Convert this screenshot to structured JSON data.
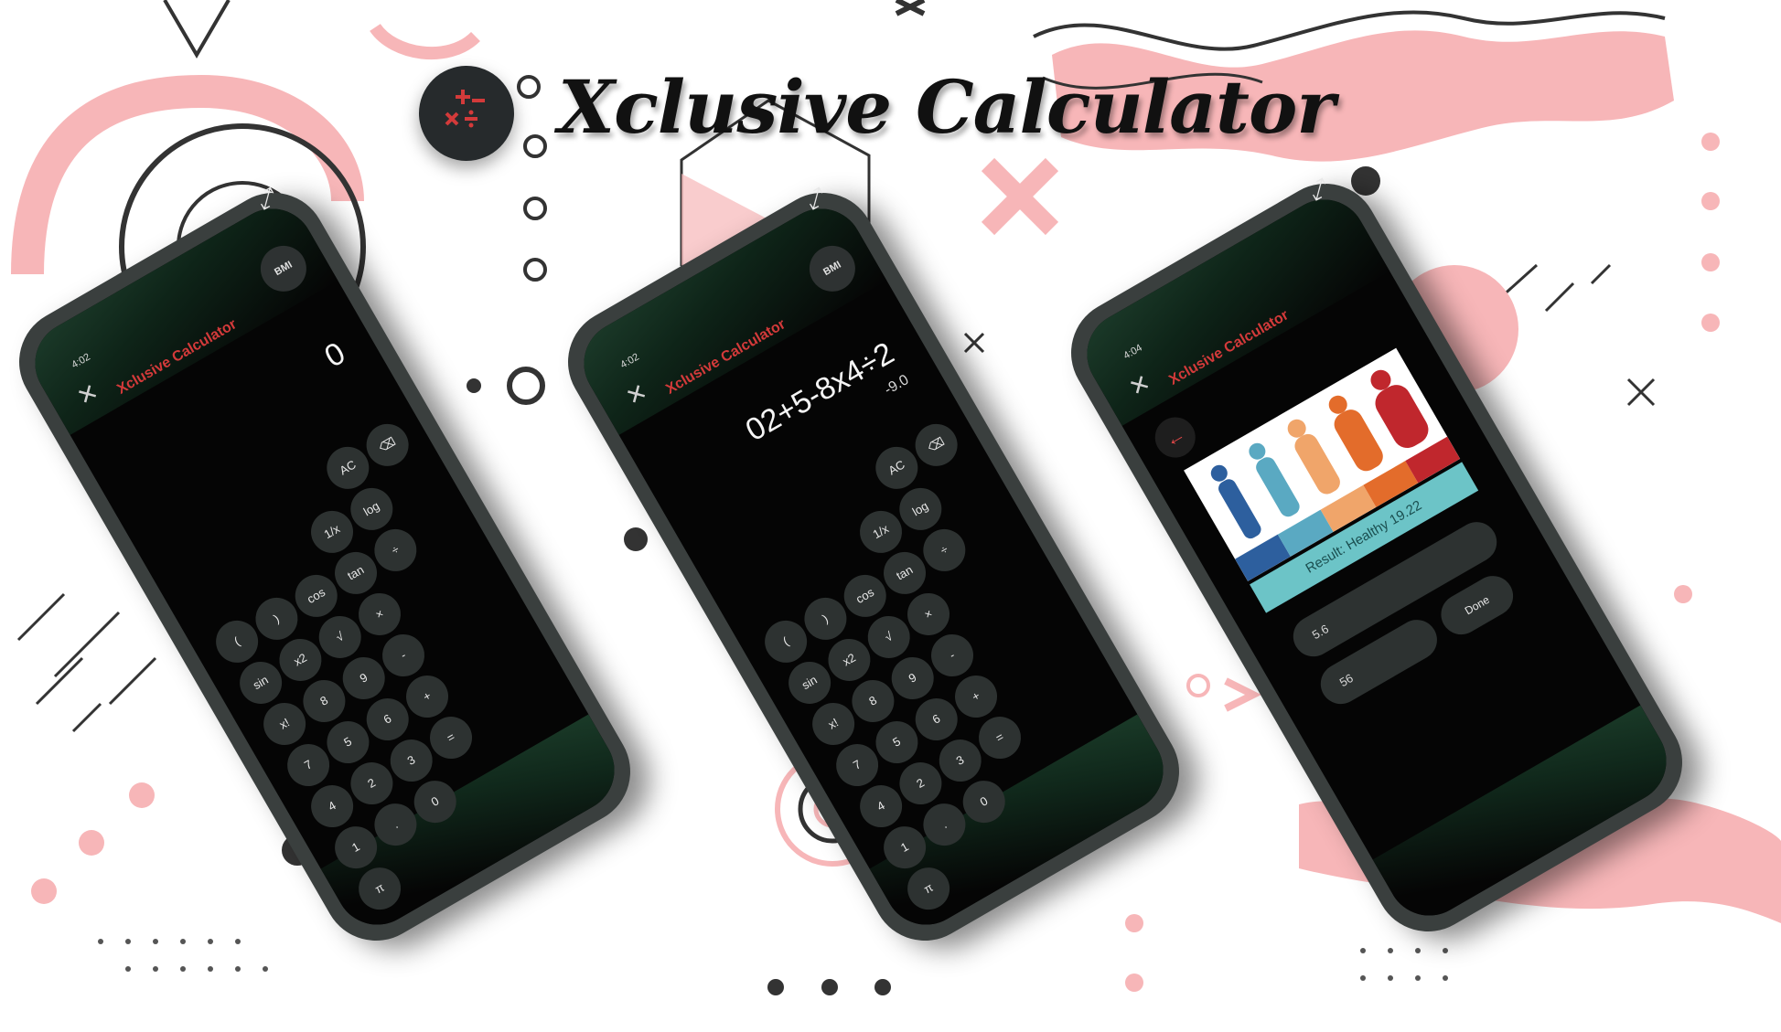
{
  "app": {
    "title": "Xclusive Calculator"
  },
  "colors": {
    "accent": "#d33a3a",
    "pink": "#f7b6b8",
    "dark": "#2d3231",
    "frame": "#3a3f3e"
  },
  "logo": {
    "icon": "math-operators-icon"
  },
  "phone1": {
    "status_time": "4:02",
    "title": "Xclusive Calculator",
    "bmi_label": "BMI",
    "display": "0",
    "keys": [
      [
        "",
        "",
        "",
        "",
        "AC",
        "⌫"
      ],
      [
        "",
        "",
        "",
        "1/x",
        "log",
        ""
      ],
      [
        "(",
        ")",
        "cos",
        "tan",
        "÷",
        ""
      ],
      [
        "sin",
        "x2",
        "√",
        "×",
        "",
        ""
      ],
      [
        "x!",
        "8",
        "9",
        "-",
        "",
        ""
      ],
      [
        "7",
        "5",
        "6",
        "+",
        "",
        ""
      ],
      [
        "4",
        "2",
        "3",
        "=",
        "",
        ""
      ],
      [
        "1",
        ".",
        "0",
        "",
        "",
        ""
      ],
      [
        "π",
        "",
        "",
        "",
        "",
        ""
      ]
    ]
  },
  "phone2": {
    "status_time": "4:02",
    "title": "Xclusive Calculator",
    "bmi_label": "BMI",
    "display": "02+5-8x4÷2",
    "result": "-9.0",
    "keys": [
      [
        "",
        "",
        "",
        "",
        "AC",
        "⌫"
      ],
      [
        "",
        "",
        "",
        "1/x",
        "log",
        ""
      ],
      [
        "(",
        ")",
        "cos",
        "tan",
        "÷",
        ""
      ],
      [
        "sin",
        "x2",
        "√",
        "×",
        "",
        ""
      ],
      [
        "x!",
        "8",
        "9",
        "-",
        "",
        ""
      ],
      [
        "7",
        "5",
        "6",
        "+",
        "",
        ""
      ],
      [
        "4",
        "2",
        "3",
        "=",
        "",
        ""
      ],
      [
        "1",
        ".",
        "0",
        "",
        "",
        ""
      ],
      [
        "π",
        "",
        "",
        "",
        "",
        ""
      ]
    ]
  },
  "phone3": {
    "status_time": "4:04",
    "title": "Xclusive Calculator",
    "result": "Result: Healthy 19.22",
    "height_value": "5.6",
    "weight_value": "56",
    "done_label": "Done"
  }
}
